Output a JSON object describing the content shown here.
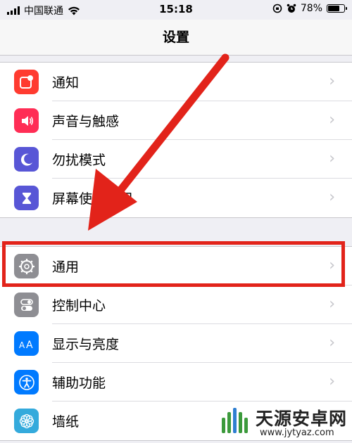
{
  "status": {
    "carrier": "中国联通",
    "time": "15:18",
    "battery_text": "78%",
    "battery_level_percent": 78
  },
  "nav": {
    "title": "设置"
  },
  "groups": [
    {
      "items": [
        {
          "label": "通知",
          "icon": "notifications-icon",
          "color": "#ff3b30"
        },
        {
          "label": "声音与触感",
          "icon": "sound-icon",
          "color": "#ff2d55"
        },
        {
          "label": "勿扰模式",
          "icon": "moon-icon",
          "color": "#5856d6"
        },
        {
          "label": "屏幕使用时间",
          "icon": "hourglass-icon",
          "color": "#5856d6"
        }
      ]
    },
    {
      "items": [
        {
          "label": "通用",
          "icon": "gear-icon",
          "color": "#8e8e93"
        },
        {
          "label": "控制中心",
          "icon": "toggles-icon",
          "color": "#8e8e93"
        },
        {
          "label": "显示与亮度",
          "icon": "display-icon",
          "color": "#007aff"
        },
        {
          "label": "辅助功能",
          "icon": "accessibility-icon",
          "color": "#007aff"
        },
        {
          "label": "墙纸",
          "icon": "wallpaper-icon",
          "color": "#34aadc"
        }
      ]
    }
  ],
  "annotation": {
    "highlight_color": "#e2231a"
  },
  "watermark": {
    "title": "天源安卓网",
    "url": "www.jytyaz.com"
  }
}
